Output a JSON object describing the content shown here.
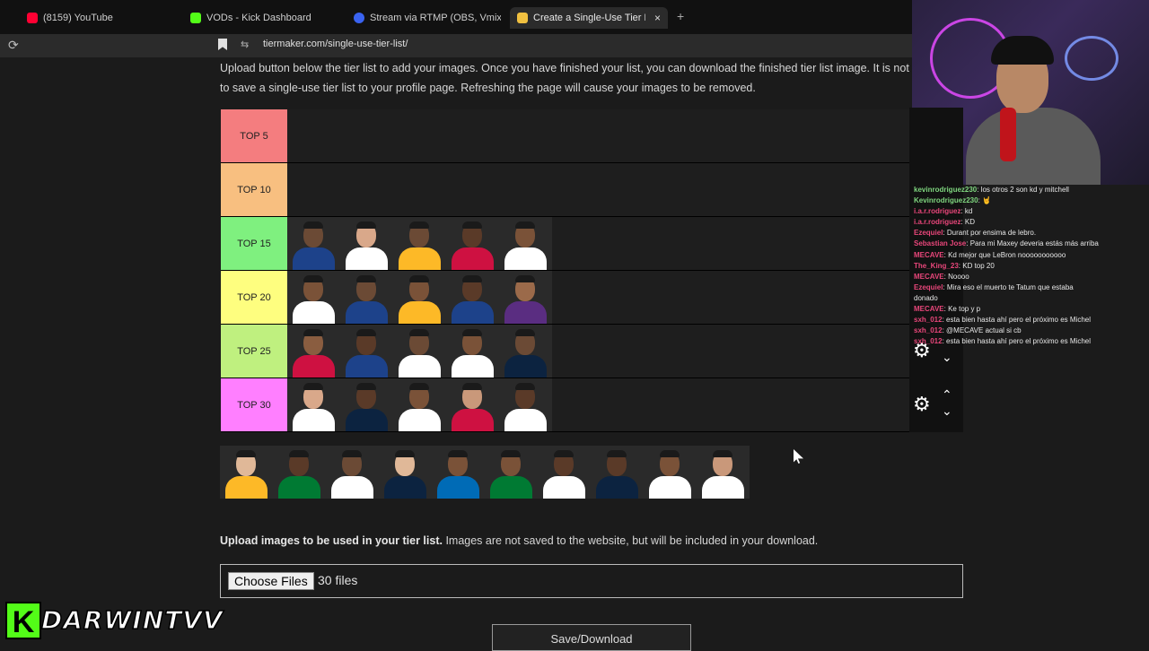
{
  "browser": {
    "tabs": [
      {
        "title": "(8159) YouTube",
        "icon": "youtube-icon",
        "color": "#ff0033"
      },
      {
        "title": "VODs - Kick Dashboard",
        "icon": "kick-icon",
        "color": "#53fc18"
      },
      {
        "title": "Stream via RTMP (OBS, Vmix, Zoo",
        "icon": "restream-icon",
        "color": "#3a63f0"
      },
      {
        "title": "Create a Single-Use Tier List (",
        "icon": "tiermaker-icon",
        "color": "#f0c040"
      }
    ],
    "close_glyph": "×",
    "new_tab_glyph": "+",
    "reload_glyph": "⟳",
    "site_info_glyph": "⇆",
    "url": "tiermaker.com/single-use-tier-list/"
  },
  "page": {
    "intro_line1": "Upload button below the tier list to add your images. Once you have finished your list, you can download the finished tier list image. It is not possible",
    "intro_line2": "to save a single-use tier list to your profile page. Refreshing the page will cause your images to be removed.",
    "tiers": [
      {
        "label": "TOP 5",
        "color": "#f47d7f",
        "players": []
      },
      {
        "label": "TOP 10",
        "color": "#f8bf80",
        "players": []
      },
      {
        "label": "TOP 15",
        "color": "#7ff07f",
        "players": [
          {
            "skin": "#6b4a35",
            "jersey": "#1d428a"
          },
          {
            "skin": "#d9a88a",
            "jersey": "#ffffff"
          },
          {
            "skin": "#6b4a35",
            "jersey": "#fdb927"
          },
          {
            "skin": "#5a3a28",
            "jersey": "#ce1141"
          },
          {
            "skin": "#7a5238",
            "jersey": "#ffffff"
          }
        ]
      },
      {
        "label": "TOP 20",
        "color": "#fefe7f",
        "players": [
          {
            "skin": "#7a5238",
            "jersey": "#ffffff"
          },
          {
            "skin": "#6b4a35",
            "jersey": "#1d428a"
          },
          {
            "skin": "#7a5238",
            "jersey": "#fdb927"
          },
          {
            "skin": "#5a3a28",
            "jersey": "#1d428a"
          },
          {
            "skin": "#9b6a4a",
            "jersey": "#5a2d81"
          }
        ]
      },
      {
        "label": "TOP 25",
        "color": "#bff07f",
        "players": [
          {
            "skin": "#8a5d40",
            "jersey": "#ce1141"
          },
          {
            "skin": "#5a3a28",
            "jersey": "#1d428a"
          },
          {
            "skin": "#6b4a35",
            "jersey": "#ffffff"
          },
          {
            "skin": "#7a5238",
            "jersey": "#ffffff"
          },
          {
            "skin": "#6b4a35",
            "jersey": "#0c2340"
          }
        ]
      },
      {
        "label": "TOP 30",
        "color": "#ff7fff",
        "players": [
          {
            "skin": "#d9a88a",
            "jersey": "#ffffff"
          },
          {
            "skin": "#5a3a28",
            "jersey": "#0c2340"
          },
          {
            "skin": "#7a5238",
            "jersey": "#ffffff"
          },
          {
            "skin": "#c9987a",
            "jersey": "#ce1141"
          },
          {
            "skin": "#5a3a28",
            "jersey": "#ffffff"
          }
        ]
      }
    ],
    "unranked_players": [
      {
        "skin": "#e0b898",
        "jersey": "#fdb927"
      },
      {
        "skin": "#5a3a28",
        "jersey": "#007a33"
      },
      {
        "skin": "#6b4a35",
        "jersey": "#ffffff"
      },
      {
        "skin": "#e0b898",
        "jersey": "#0c2340"
      },
      {
        "skin": "#7a5238",
        "jersey": "#006bb6"
      },
      {
        "skin": "#7a5238",
        "jersey": "#007a33"
      },
      {
        "skin": "#5a3a28",
        "jersey": "#ffffff"
      },
      {
        "skin": "#5a3a28",
        "jersey": "#0c2340"
      },
      {
        "skin": "#7a5238",
        "jersey": "#ffffff"
      },
      {
        "skin": "#c9987a",
        "jersey": "#ffffff"
      }
    ],
    "upload_bold": "Upload images to be used in your tier list.",
    "upload_rest": " Images are not saved to the website, but will be included in your download.",
    "choose_files_label": "Choose Files",
    "file_count": "30 files",
    "save_label": "Save/Download"
  },
  "chat": {
    "messages": [
      {
        "user": "kevinrodriguez230",
        "color": "#7fd67f",
        "text": ": los otros 2 son kd y mitchell"
      },
      {
        "user": "Kevinrodriguez230",
        "color": "#7fd67f",
        "text": ": 🤘"
      },
      {
        "user": "i.a.r.rodriguez",
        "color": "#e8467a",
        "text": ": kd"
      },
      {
        "user": "i.a.r.rodriguez",
        "color": "#e8467a",
        "text": ": KD"
      },
      {
        "user": "Ezequiel",
        "color": "#e8467a",
        "text": ": Durant por ensima de lebro."
      },
      {
        "user": "Sebastian Jose",
        "color": "#e8467a",
        "text": ": Para mi Maxey deveria estás más arriba"
      },
      {
        "user": "MECAVE",
        "color": "#e8467a",
        "text": ": Kd mejor que LeBron nooooooooooo"
      },
      {
        "user": "The_King_23",
        "color": "#e8467a",
        "text": ": KD top 20"
      },
      {
        "user": "MECAVE",
        "color": "#e8467a",
        "text": ": Noooo"
      },
      {
        "user": "Ezequiel",
        "color": "#e8467a",
        "text": ": Mira eso el muerto te Tatum que estaba"
      },
      {
        "user": "",
        "color": "#e8e8e8",
        "text": "donado"
      },
      {
        "user": "MECAVE",
        "color": "#e8467a",
        "text": ": Ke top y p"
      },
      {
        "user": "sxh_012",
        "color": "#e8467a",
        "text": ": esta bien hasta ahí pero el próximo es Michel"
      },
      {
        "user": "sxh_012",
        "color": "#e8467a",
        "text": ": @MECAVE actual si cb"
      },
      {
        "user": "sxh_012",
        "color": "#e8467a",
        "text": ": esta bien hasta ahí pero el próximo es Michel"
      }
    ]
  },
  "overlay": {
    "gear_glyph": "⚙",
    "up_glyph": "⌃",
    "down_glyph": "⌄",
    "kick_letter": "K",
    "streamer_name": "DARWINTVV",
    "kick_color": "#53fc18"
  }
}
